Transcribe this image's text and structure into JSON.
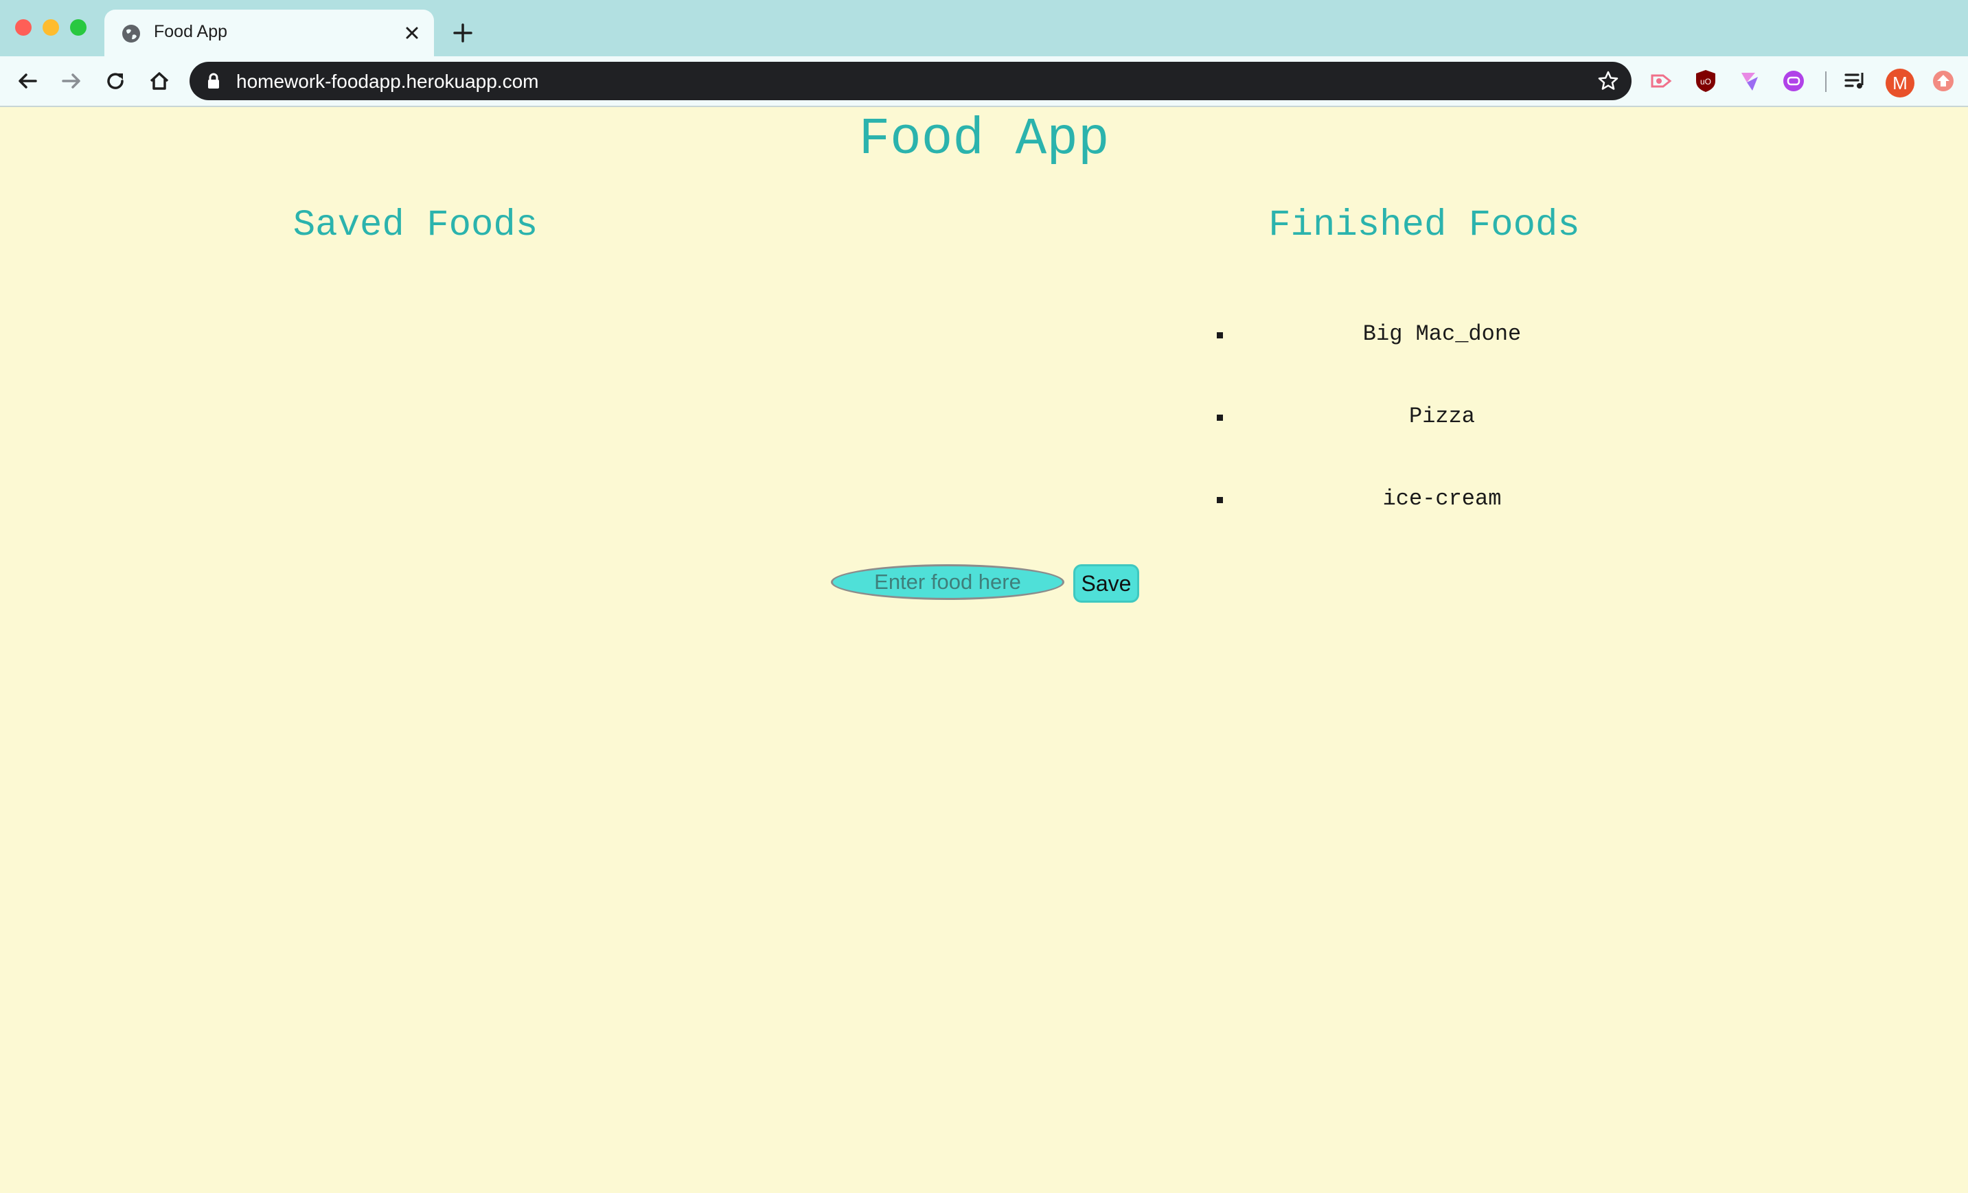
{
  "browser": {
    "tab_title": "Food App",
    "url": "homework-foodapp.herokuapp.com",
    "profile_initial": "M",
    "icons": [
      "globe-icon",
      "close-icon",
      "plus-icon",
      "back-icon",
      "forward-icon",
      "reload-icon",
      "home-icon",
      "lock-icon",
      "star-icon",
      "extension-icon",
      "playlist-icon",
      "avatar"
    ]
  },
  "page": {
    "title": "Food App",
    "saved_heading": "Saved Foods",
    "finished_heading": "Finished Foods",
    "saved_foods": [],
    "finished_foods": [
      "Big Mac_done",
      "Pizza",
      "ice-cream"
    ],
    "input_placeholder": "Enter food here",
    "input_value": "",
    "save_label": "Save"
  },
  "colors": {
    "background": "#fcf9d3",
    "heading": "#2bb3ad",
    "input_fill": "#4fe0d8",
    "tabbar": "#b2e0e1"
  }
}
